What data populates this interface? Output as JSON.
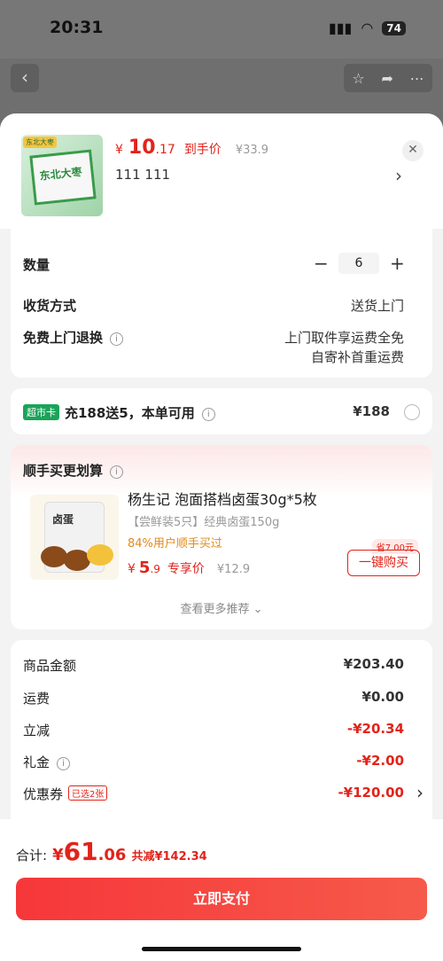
{
  "status_bar": {
    "time": "20:31",
    "battery": "74"
  },
  "product": {
    "thumb_brand": "东北大枣",
    "thumb_title": "东北大枣",
    "price_currency": "¥",
    "price_int": "10",
    "price_dec": ".17",
    "price_label": "到手价",
    "original_price": "¥33.9",
    "spec": "111  111"
  },
  "options": {
    "quantity_label": "数量",
    "quantity": "6",
    "minus": "−",
    "plus": "+",
    "delivery_label": "收货方式",
    "delivery_value": "送货上门",
    "return_label": "免费上门退换",
    "return_line1": "上门取件享运费全免",
    "return_line2": "自寄补首重运费"
  },
  "club": {
    "badge": "超市卡",
    "text": "充188送5，本单可用",
    "amount": "¥188"
  },
  "upsell": {
    "title": "顺手买更划算",
    "product_name": "杨生记 泡面搭档卤蛋30g*5枚",
    "sub": "【尝鲜装5只】经典卤蛋150g",
    "popularity": "84%用户顺手买过",
    "price_currency": "¥",
    "price_int": "5",
    "price_dec": ".9",
    "price_label": "专享价",
    "original_price": "¥12.9",
    "save_badge": "省7.00元",
    "buy_button": "一键购买",
    "more": "查看更多推荐",
    "bag_label": "卤蛋"
  },
  "summary": {
    "rows": [
      {
        "label": "商品金额",
        "value": "¥203.40"
      },
      {
        "label": "运费",
        "value": "¥0.00"
      },
      {
        "label": "立减",
        "value": "-¥20.34"
      },
      {
        "label": "礼金",
        "value": "-¥2.00"
      },
      {
        "label": "优惠券",
        "tag": "已选2张",
        "value": "-¥120.00"
      }
    ]
  },
  "footer": {
    "total_label": "合计:",
    "currency": "¥",
    "total_int": "61",
    "total_dec": ".06",
    "discount": "共减¥142.34",
    "pay_button": "立即支付"
  }
}
